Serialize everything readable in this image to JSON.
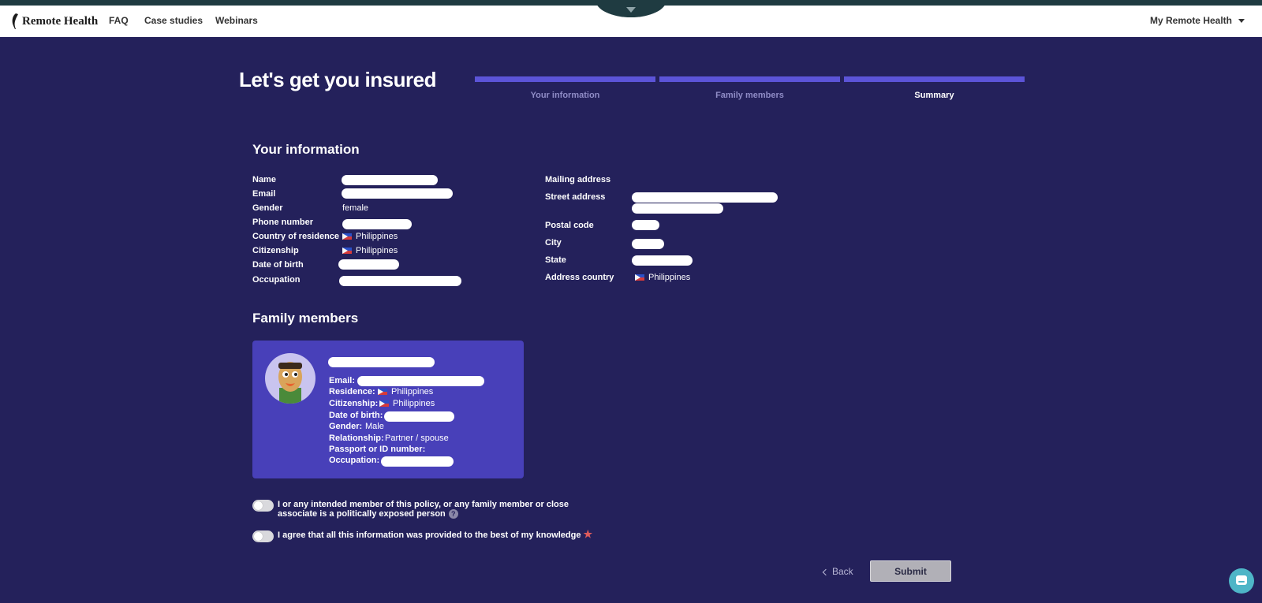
{
  "nav": {
    "brand": "Remote Health",
    "links": [
      "FAQ",
      "Case studies",
      "Webinars"
    ],
    "account": "My Remote Health"
  },
  "page": {
    "title": "Let's get you insured",
    "steps": [
      {
        "label": "Your information",
        "state": "done"
      },
      {
        "label": "Family members",
        "state": "done"
      },
      {
        "label": "Summary",
        "state": "active"
      }
    ]
  },
  "your_information": {
    "title": "Your information",
    "left": [
      {
        "label": "Name",
        "value": null
      },
      {
        "label": "Email",
        "value": null
      },
      {
        "label": "Gender",
        "value": "female"
      },
      {
        "label": "Phone number",
        "value": null
      },
      {
        "label": "Country of residence",
        "value": "Philippines",
        "flag": "ph-flag-icon"
      },
      {
        "label": "Citizenship",
        "value": "Philippines",
        "flag": "ph-flag-icon"
      },
      {
        "label": "Date of birth",
        "value": null
      },
      {
        "label": "Occupation",
        "value": null
      }
    ],
    "right": [
      {
        "label": "Mailing address",
        "value": null
      },
      {
        "label": "Street address",
        "value": null
      },
      {
        "label": "Postal code",
        "value": null
      },
      {
        "label": "City",
        "value": null
      },
      {
        "label": "State",
        "value": null
      },
      {
        "label": "Address country",
        "value": "Philippines",
        "flag": "ph-flag-icon"
      }
    ]
  },
  "family": {
    "title": "Family members",
    "member": {
      "email_label": "Email:",
      "residence_label": "Residence:",
      "residence": "Philippines",
      "citizenship_label": "Citizenship:",
      "citizenship": "Philippines",
      "dob_label": "Date of birth:",
      "gender_label": "Gender:",
      "gender": "Male",
      "relationship_label": "Relationship:",
      "relationship": "Partner / spouse",
      "passport_label": "Passport or ID number:",
      "occupation_label": "Occupation:"
    }
  },
  "consents": {
    "pep_line1": "I or any intended member of this policy, or any family member or close",
    "pep_line2": "associate is a politically exposed person",
    "pep_help": "?",
    "agree": "I agree that all this information was provided to the best of my knowledge",
    "required_mark": "★"
  },
  "actions": {
    "back": "Back",
    "submit": "Submit"
  },
  "colors": {
    "background": "#24215b",
    "accent": "#5c54d8",
    "card": "#4840b9",
    "chat": "#4eb5c7"
  }
}
